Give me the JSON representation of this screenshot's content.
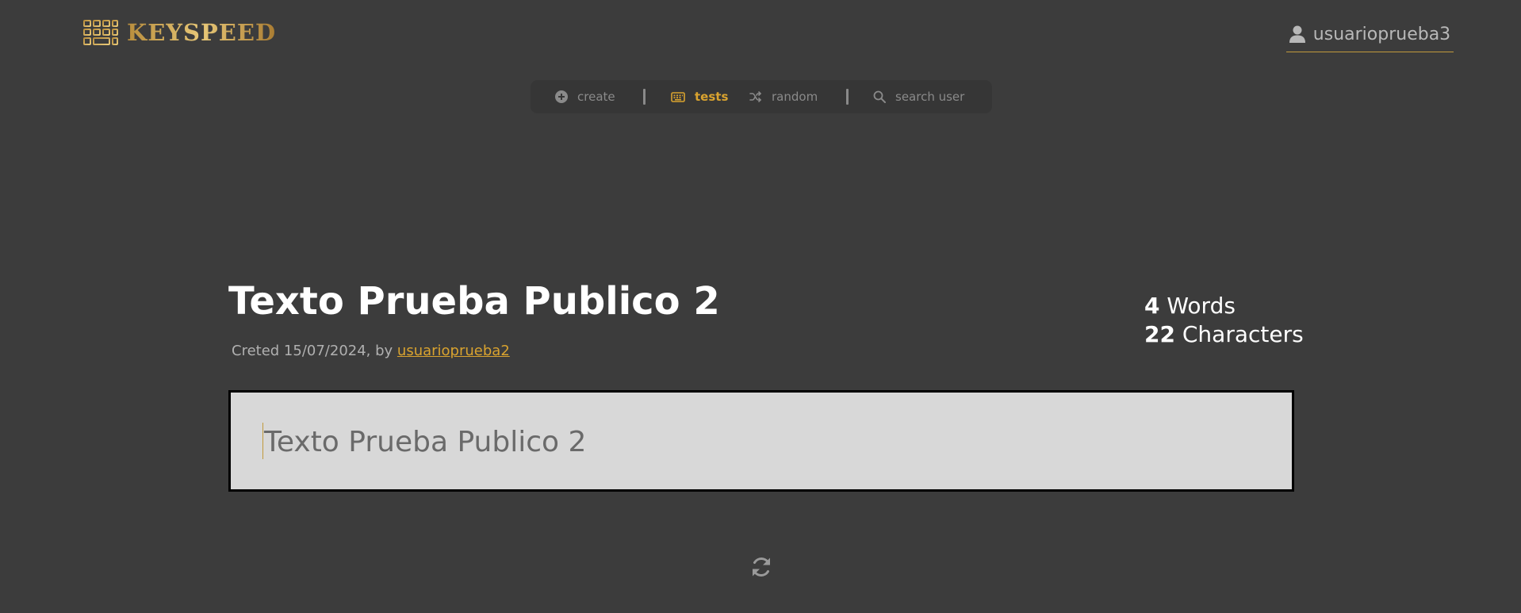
{
  "header": {
    "logo_text": "KEYSPEED",
    "user_name": "usuarioprueba3"
  },
  "nav": {
    "items": [
      {
        "label": "create",
        "icon": "plus-circle-icon",
        "active": false
      },
      {
        "label": "tests",
        "icon": "keyboard-icon",
        "active": true
      },
      {
        "label": "random",
        "icon": "shuffle-icon",
        "active": false
      },
      {
        "label": "search user",
        "icon": "search-icon",
        "active": false
      }
    ]
  },
  "test": {
    "title": "Texto Prueba Publico 2",
    "created_prefix": "Creted 15/07/2024, by ",
    "author": "usuarioprueba2",
    "words_count": "4",
    "words_label": " Words",
    "chars_count": "22",
    "chars_label": " Characters",
    "text": "Texto Prueba Publico 2"
  },
  "colors": {
    "background": "#3c3c3c",
    "accent": "#d9a32f",
    "nav_bg": "#363636",
    "text_box_bg": "#d8d8d8"
  },
  "icons": {
    "logo": "keyboard-logo-icon",
    "user": "user-icon",
    "refresh": "refresh-icon"
  }
}
